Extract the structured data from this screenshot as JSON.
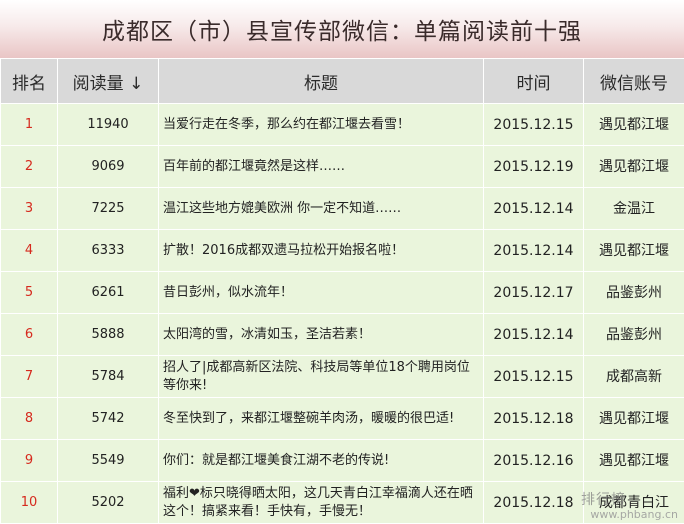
{
  "page_title": "成都区（市）县宣传部微信：单篇阅读前十强",
  "headers": {
    "rank": "排名",
    "reads": "阅读量",
    "sort_indicator": "↓",
    "title": "标题",
    "date": "时间",
    "account": "微信账号"
  },
  "rows": [
    {
      "rank": "1",
      "reads": "11940",
      "title": "当爱行走在冬季，那么约在都江堰去看雪！",
      "date": "2015.12.15",
      "account": "遇见都江堰"
    },
    {
      "rank": "2",
      "reads": "9069",
      "title": "百年前的都江堰竟然是这样……",
      "date": "2015.12.19",
      "account": "遇见都江堰"
    },
    {
      "rank": "3",
      "reads": "7225",
      "title": "温江这些地方媲美欧洲 你一定不知道……",
      "date": "2015.12.14",
      "account": "金温江"
    },
    {
      "rank": "4",
      "reads": "6333",
      "title": "扩散！2016成都双遗马拉松开始报名啦！",
      "date": "2015.12.14",
      "account": "遇见都江堰"
    },
    {
      "rank": "5",
      "reads": "6261",
      "title": "昔日彭州，似水流年！",
      "date": "2015.12.17",
      "account": "品鉴彭州"
    },
    {
      "rank": "6",
      "reads": "5888",
      "title": "太阳湾的雪，冰清如玉，圣洁若素！",
      "date": "2015.12.14",
      "account": "品鉴彭州"
    },
    {
      "rank": "7",
      "reads": "5784",
      "title": "招人了|成都高新区法院、科技局等单位18个聘用岗位等你来!",
      "date": "2015.12.15",
      "account": "成都高新"
    },
    {
      "rank": "8",
      "reads": "5742",
      "title": "冬至快到了，来都江堰整碗羊肉汤，暖暖的很巴适!",
      "date": "2015.12.18",
      "account": "遇见都江堰"
    },
    {
      "rank": "9",
      "reads": "5549",
      "title": "你们：就是都江堰美食江湖不老的传说!",
      "date": "2015.12.16",
      "account": "遇见都江堰"
    },
    {
      "rank": "10",
      "reads": "5202",
      "title": "福利❤标只晓得晒太阳，这几天青白江幸福滴人还在晒这个！搞紧来看！手快有，手慢无！",
      "date": "2015.12.18",
      "account": "成都青白江"
    }
  ],
  "watermark": {
    "logo_text": "排行榜",
    "url_text": "www.phbang.cn"
  }
}
